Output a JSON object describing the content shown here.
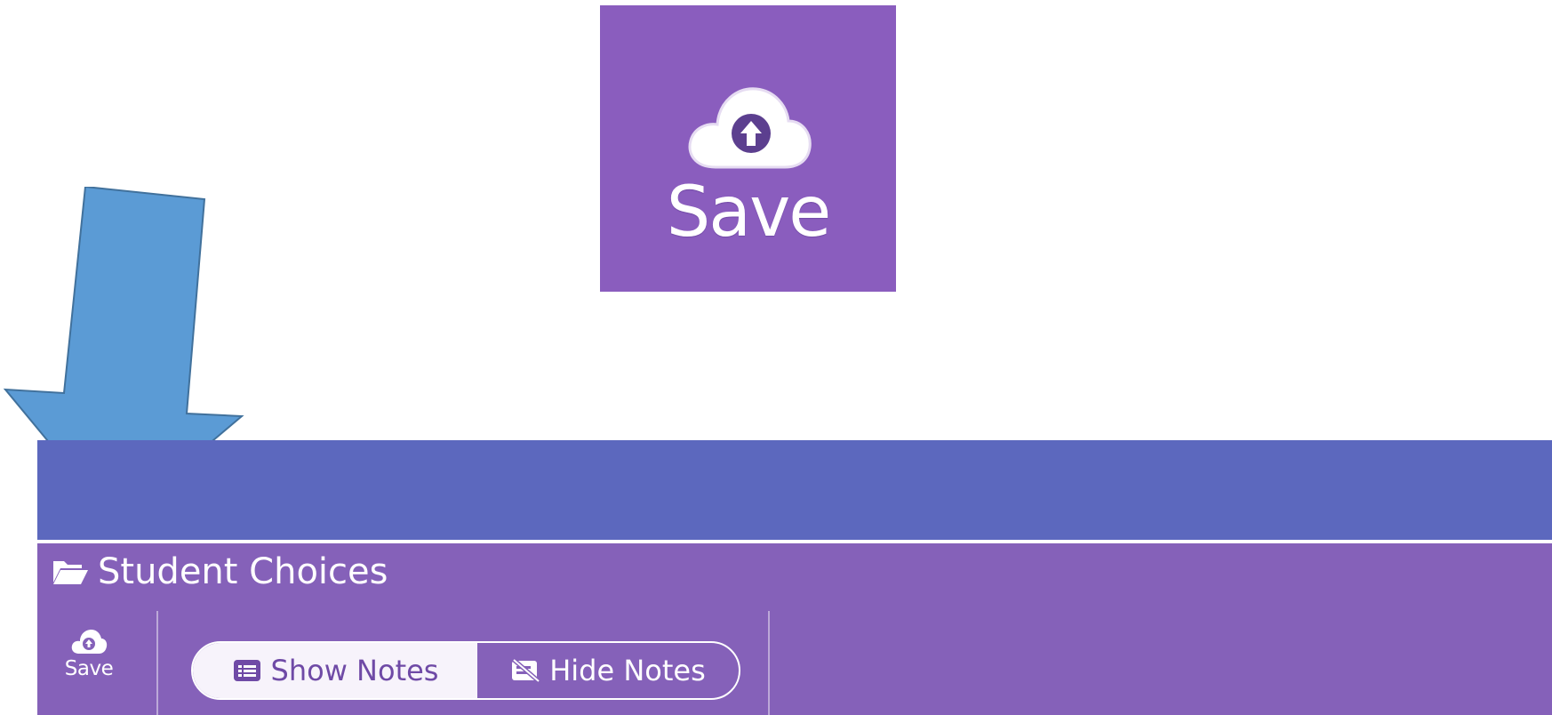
{
  "zoom_callout": {
    "label": "Save",
    "icon": "cloud-upload-icon"
  },
  "annotation": {
    "icon": "down-arrow-pointer",
    "color": "#5b9bd5"
  },
  "panel": {
    "title": "Student Choices",
    "title_icon": "folder-open-icon"
  },
  "toolbar": {
    "save_label": "Save",
    "save_icon": "cloud-upload-icon",
    "show_notes_label": "Show Notes",
    "show_notes_icon": "notes-list-icon",
    "hide_notes_label": "Hide Notes",
    "hide_notes_icon": "notes-hidden-icon",
    "selected": "Show Notes"
  },
  "colors": {
    "panel": "#8561b9",
    "top_bar": "#5c68be",
    "zoom_card": "#8a5dbe",
    "toggle_active_bg": "#f7f3fb",
    "toggle_active_text": "#6f4aa6",
    "text": "#ffffff"
  }
}
